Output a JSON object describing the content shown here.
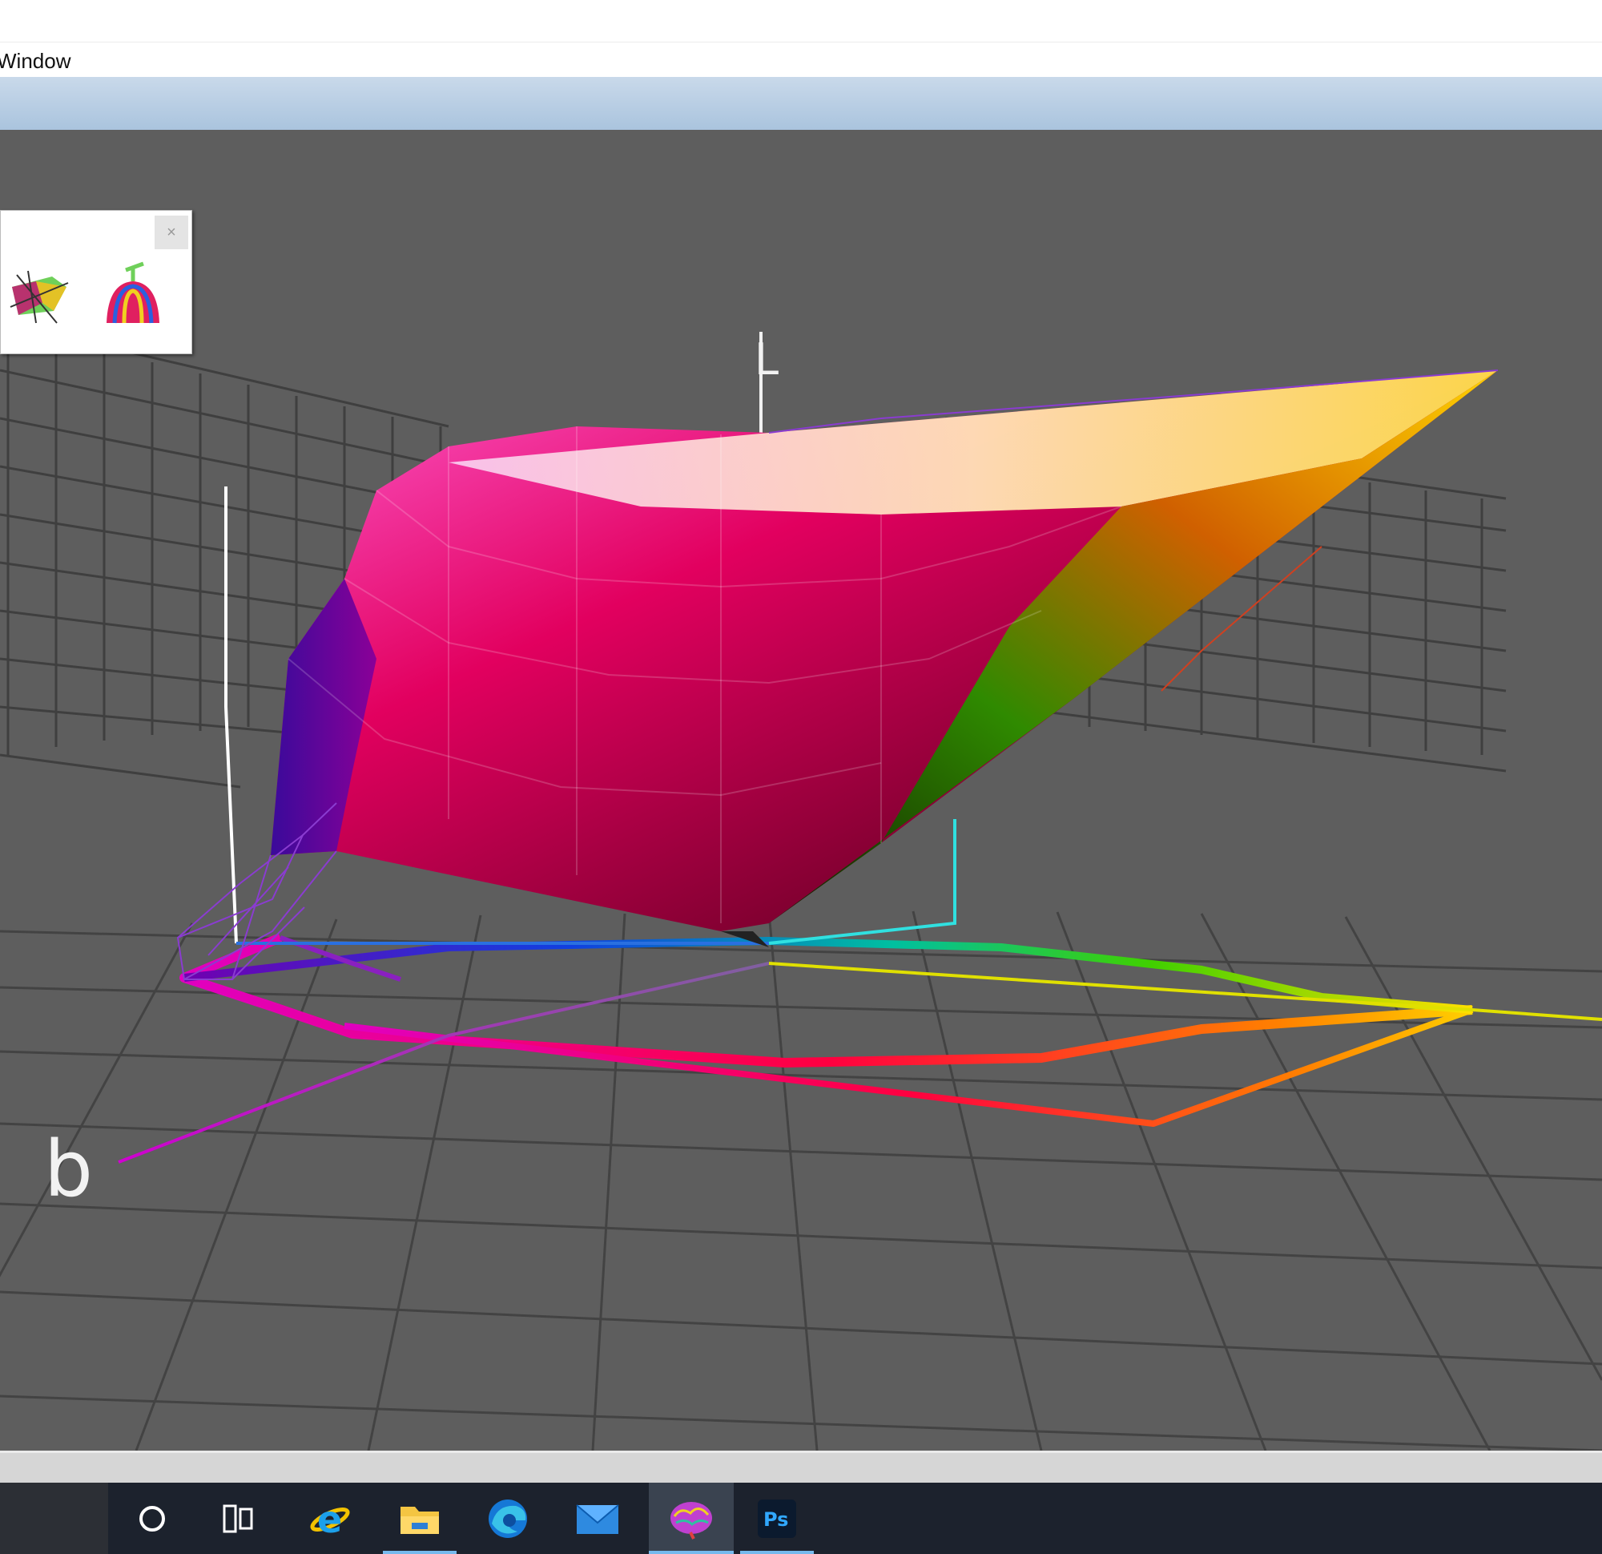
{
  "menubar": {
    "items": [
      "Window"
    ]
  },
  "viewer": {
    "axis_labels": {
      "l": "L",
      "b": "b"
    },
    "palette": {
      "close_label": "×"
    },
    "background_color": "#5e5e5e",
    "grid_color": "#3f3f3f"
  },
  "taskbar": {
    "buttons": [
      {
        "icon": "cortana-icon",
        "state": "idle"
      },
      {
        "icon": "task-view-icon",
        "state": "idle"
      },
      {
        "icon": "internet-explorer-icon",
        "state": "idle"
      },
      {
        "icon": "file-explorer-icon",
        "state": "running"
      },
      {
        "icon": "edge-icon",
        "state": "idle"
      },
      {
        "icon": "mail-icon",
        "state": "idle"
      },
      {
        "icon": "colorthink-brain-icon",
        "state": "active"
      },
      {
        "icon": "photoshop-icon",
        "state": "running"
      }
    ],
    "photoshop_label": "Ps",
    "accent_color": "#76b9ed"
  }
}
